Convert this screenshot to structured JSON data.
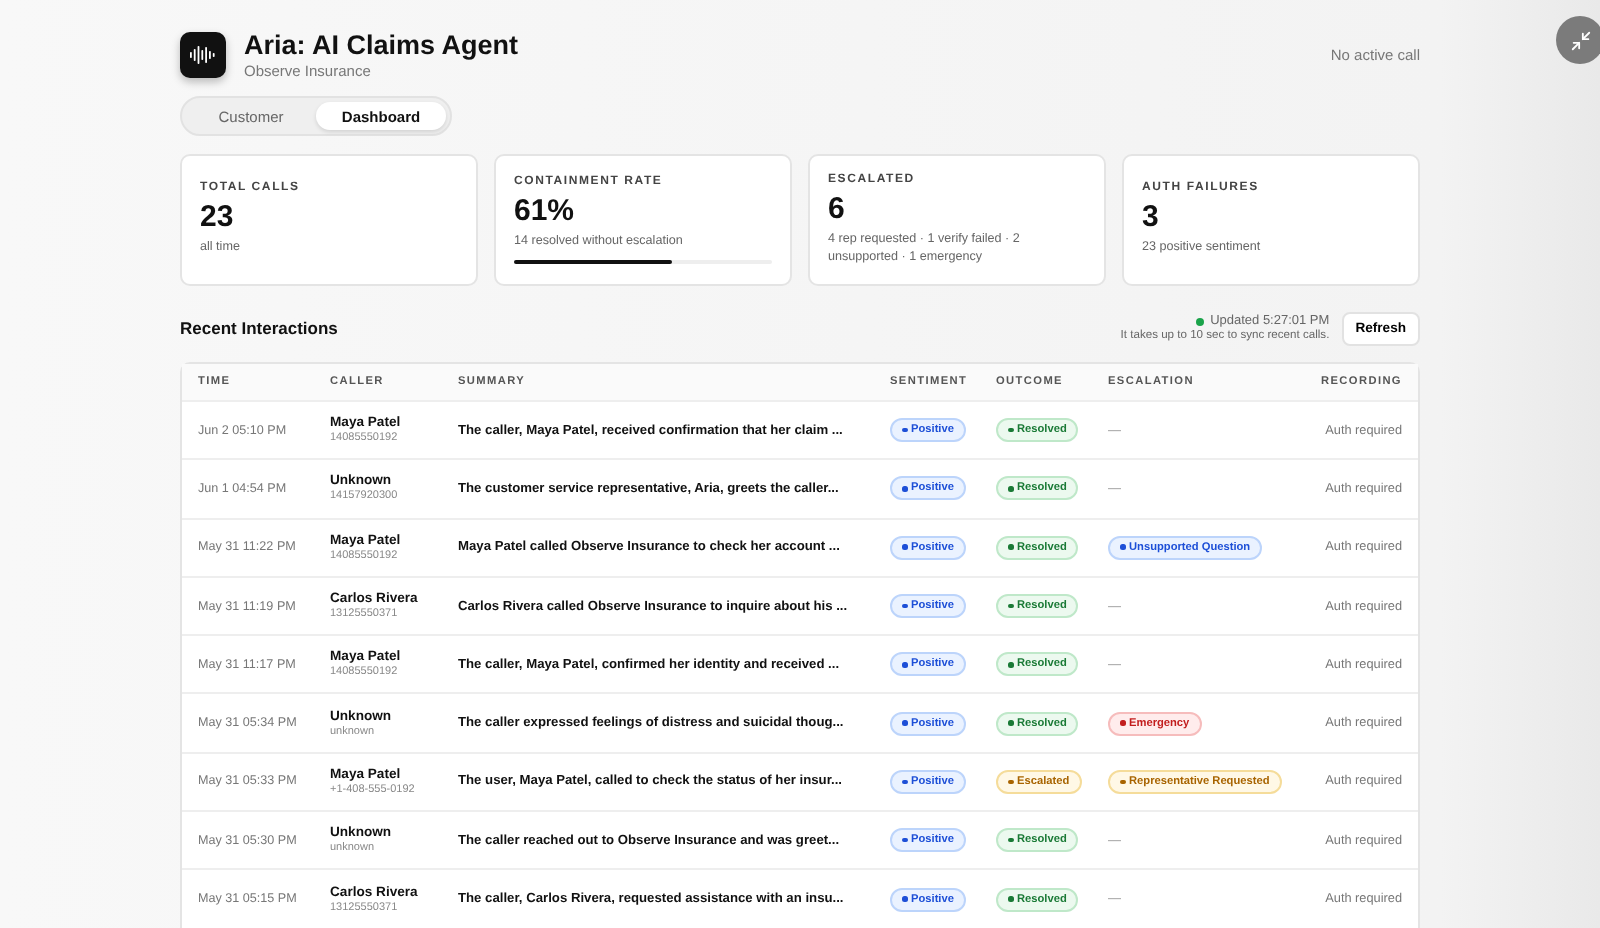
{
  "header": {
    "title": "Aria: AI Claims Agent",
    "subtitle": "Observe Insurance",
    "call_status": "No active call"
  },
  "tabs": [
    {
      "label": "Customer",
      "selected": false
    },
    {
      "label": "Dashboard",
      "selected": true
    }
  ],
  "stats": [
    {
      "label": "TOTAL CALLS",
      "value": "23",
      "note": "all time"
    },
    {
      "label": "CONTAINMENT RATE",
      "value": "61%",
      "note": "14 resolved without escalation",
      "level": 0.61
    },
    {
      "label": "ESCALATED",
      "value": "6",
      "note": "4 rep requested · 1 verify failed · 2 unsupported · 1 emergency"
    },
    {
      "label": "AUTH FAILURES",
      "value": "3",
      "note": "23 positive sentiment"
    }
  ],
  "interactions": {
    "title": "Recent Interactions",
    "updated": "Updated 5:27:01 PM",
    "sync_note": "It takes up to 10 sec to sync recent calls.",
    "refresh": "Refresh",
    "columns": [
      "TIME",
      "CALLER",
      "SUMMARY",
      "SENTIMENT",
      "OUTCOME",
      "ESCALATION",
      "RECORDING"
    ],
    "rows": [
      {
        "time": "Jun 2 05:10 PM",
        "caller": "Maya Patel",
        "phone": "14085550192",
        "summary": "The caller, Maya Patel, received confirmation that her claim ...",
        "sentiment": {
          "label": "Positive",
          "kind": "info"
        },
        "outcome": {
          "label": "Resolved",
          "kind": "success"
        },
        "escalation": {
          "label": "—",
          "kind": "none"
        },
        "recording": "Auth required"
      },
      {
        "time": "Jun 1 04:54 PM",
        "caller": "Unknown",
        "phone": "14157920300",
        "summary": "The customer service representative, Aria, greets the caller...",
        "sentiment": {
          "label": "Positive",
          "kind": "info"
        },
        "outcome": {
          "label": "Resolved",
          "kind": "success"
        },
        "escalation": {
          "label": "—",
          "kind": "none"
        },
        "recording": "Auth required"
      },
      {
        "time": "May 31 11:22 PM",
        "caller": "Maya Patel",
        "phone": "14085550192",
        "summary": "Maya Patel called Observe Insurance to check her account ...",
        "sentiment": {
          "label": "Positive",
          "kind": "info"
        },
        "outcome": {
          "label": "Resolved",
          "kind": "success"
        },
        "escalation": {
          "label": "Unsupported Question",
          "kind": "info"
        },
        "recording": "Auth required"
      },
      {
        "time": "May 31 11:19 PM",
        "caller": "Carlos Rivera",
        "phone": "13125550371",
        "summary": "Carlos Rivera called Observe Insurance to inquire about his ...",
        "sentiment": {
          "label": "Positive",
          "kind": "info"
        },
        "outcome": {
          "label": "Resolved",
          "kind": "success"
        },
        "escalation": {
          "label": "—",
          "kind": "none"
        },
        "recording": "Auth required"
      },
      {
        "time": "May 31 11:17 PM",
        "caller": "Maya Patel",
        "phone": "14085550192",
        "summary": "The caller, Maya Patel, confirmed her identity and received ...",
        "sentiment": {
          "label": "Positive",
          "kind": "info"
        },
        "outcome": {
          "label": "Resolved",
          "kind": "success"
        },
        "escalation": {
          "label": "—",
          "kind": "none"
        },
        "recording": "Auth required"
      },
      {
        "time": "May 31 05:34 PM",
        "caller": "Unknown",
        "phone": "unknown",
        "summary": "The caller expressed feelings of distress and suicidal thoug...",
        "sentiment": {
          "label": "Positive",
          "kind": "info"
        },
        "outcome": {
          "label": "Resolved",
          "kind": "success"
        },
        "escalation": {
          "label": "Emergency",
          "kind": "danger"
        },
        "recording": "Auth required"
      },
      {
        "time": "May 31 05:33 PM",
        "caller": "Maya Patel",
        "phone": "+1-408-555-0192",
        "summary": "The user, Maya Patel, called to check the status of her insur...",
        "sentiment": {
          "label": "Positive",
          "kind": "info"
        },
        "outcome": {
          "label": "Escalated",
          "kind": "warning"
        },
        "escalation": {
          "label": "Representative Requested",
          "kind": "warning"
        },
        "recording": "Auth required"
      },
      {
        "time": "May 31 05:30 PM",
        "caller": "Unknown",
        "phone": "unknown",
        "summary": "The caller reached out to Observe Insurance and was greet...",
        "sentiment": {
          "label": "Positive",
          "kind": "info"
        },
        "outcome": {
          "label": "Resolved",
          "kind": "success"
        },
        "escalation": {
          "label": "—",
          "kind": "none"
        },
        "recording": "Auth required"
      },
      {
        "time": "May 31 05:15 PM",
        "caller": "Carlos Rivera",
        "phone": "13125550371",
        "summary": "The caller, Carlos Rivera, requested assistance with an insu...",
        "sentiment": {
          "label": "Positive",
          "kind": "info"
        },
        "outcome": {
          "label": "Resolved",
          "kind": "success"
        },
        "escalation": {
          "label": "—",
          "kind": "none"
        },
        "recording": "Auth required"
      }
    ]
  }
}
